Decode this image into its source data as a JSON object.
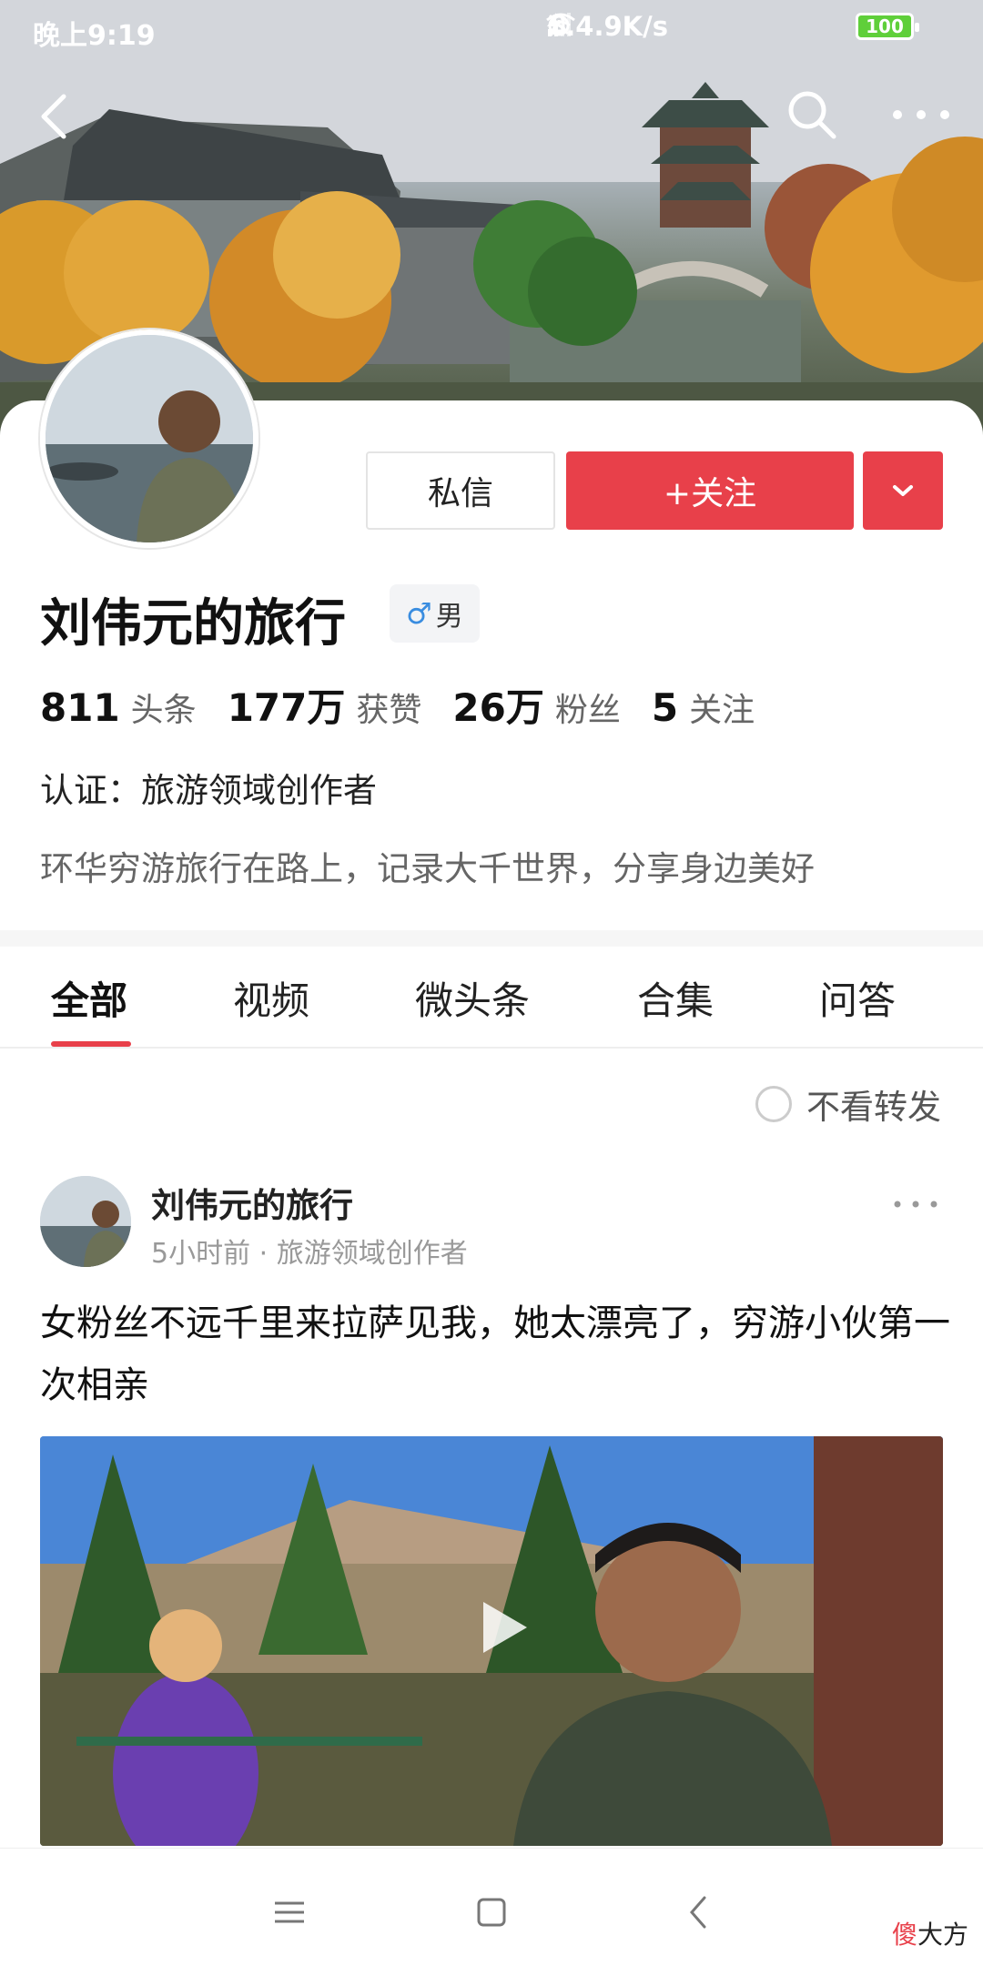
{
  "status_bar": {
    "time": "晚上9:19",
    "speed": "...4.9K/s",
    "battery": "100"
  },
  "profile": {
    "name": "刘伟元的旅行",
    "gender": "男",
    "message_button": "私信",
    "follow_button": "+关注",
    "stats": [
      {
        "num": "811",
        "label": "头条"
      },
      {
        "num": "177万",
        "label": "获赞"
      },
      {
        "num": "26万",
        "label": "粉丝"
      },
      {
        "num": "5",
        "label": "关注"
      }
    ],
    "verification": "认证：旅游领域创作者",
    "bio": "环华穷游旅行在路上，记录大千世界，分享身边美好"
  },
  "tabs": [
    {
      "label": "全部",
      "active": true
    },
    {
      "label": "视频",
      "active": false
    },
    {
      "label": "微头条",
      "active": false
    },
    {
      "label": "合集",
      "active": false
    },
    {
      "label": "问答",
      "active": false
    }
  ],
  "feed": {
    "filter_label": "不看转发",
    "post": {
      "author": "刘伟元的旅行",
      "meta": "5小时前 · 旅游领域创作者",
      "text": "女粉丝不远千里来拉萨见我，她太漂亮了，穷游小伙第一次相亲"
    }
  },
  "watermark": {
    "part1": "傻",
    "part2": "大方"
  },
  "colors": {
    "accent": "#e8404a",
    "text": "#222222",
    "muted": "#666666"
  }
}
